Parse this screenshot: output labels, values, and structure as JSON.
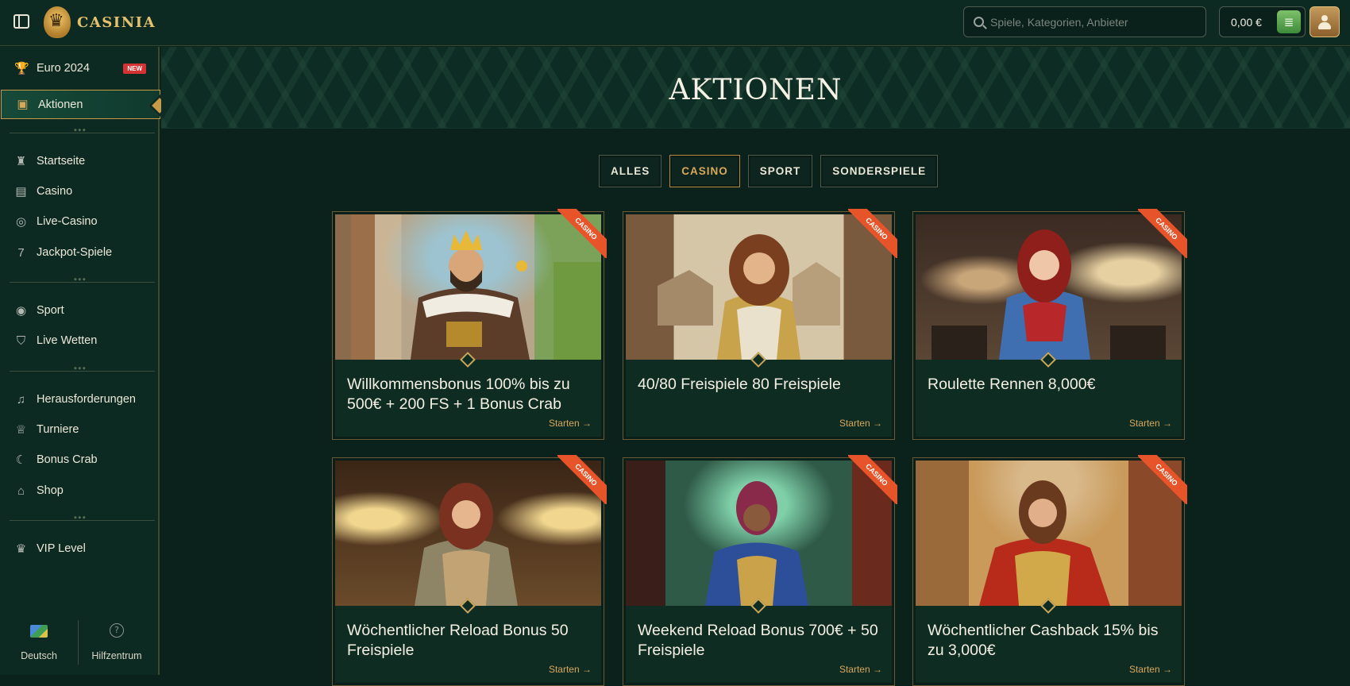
{
  "header": {
    "logo_text": "CASINIA",
    "search_placeholder": "Spiele, Kategorien, Anbieter",
    "balance": "0,00 €"
  },
  "sidebar": {
    "items": [
      {
        "label": "Euro 2024",
        "icon": "trophy-icon",
        "badge": "NEW"
      },
      {
        "label": "Aktionen",
        "icon": "treasure-chest-icon"
      },
      {
        "label": "Startseite",
        "icon": "castle-icon"
      },
      {
        "label": "Casino",
        "icon": "slot-machine-icon"
      },
      {
        "label": "Live-Casino",
        "icon": "roulette-icon"
      },
      {
        "label": "Jackpot-Spiele",
        "icon": "seven-icon"
      },
      {
        "label": "Sport",
        "icon": "soccer-ball-icon"
      },
      {
        "label": "Live Wetten",
        "icon": "shield-icon"
      },
      {
        "label": "Herausforderungen",
        "icon": "bell-icon"
      },
      {
        "label": "Turniere",
        "icon": "cup-icon"
      },
      {
        "label": "Bonus Crab",
        "icon": "crab-claw-icon"
      },
      {
        "label": "Shop",
        "icon": "shop-icon"
      },
      {
        "label": "VIP Level",
        "icon": "crown-icon"
      }
    ],
    "footer": {
      "language": "Deutsch",
      "help": "Hilfzentrum"
    }
  },
  "main": {
    "title": "AKTIONEN",
    "filters": [
      "ALLES",
      "CASINO",
      "SPORT",
      "SONDERSPIELE"
    ],
    "active_filter": "CASINO",
    "cards": [
      {
        "title": "Willkommensbonus 100% bis zu 500€ + 200 FS + 1 Bonus Crab",
        "ribbon": "CASINO",
        "cta": "Starten →"
      },
      {
        "title": "40/80 Freispiele 80 Freispiele",
        "ribbon": "CASINO",
        "cta": "Starten →"
      },
      {
        "title": "Roulette Rennen 8,000€",
        "ribbon": "CASINO",
        "cta": "Starten →"
      },
      {
        "title": "Wöchentlicher Reload Bonus 50 Freispiele",
        "ribbon": "CASINO",
        "cta": "Starten →"
      },
      {
        "title": "Weekend Reload Bonus 700€ + 50 Freispiele",
        "ribbon": "CASINO",
        "cta": "Starten →"
      },
      {
        "title": "Wöchentlicher Cashback 15% bis zu 3,000€",
        "ribbon": "CASINO",
        "cta": "Starten →"
      }
    ]
  },
  "colors": {
    "accent_gold": "#c69a46",
    "ribbon_orange": "#e7542a",
    "bg_dark": "#0b221c"
  }
}
